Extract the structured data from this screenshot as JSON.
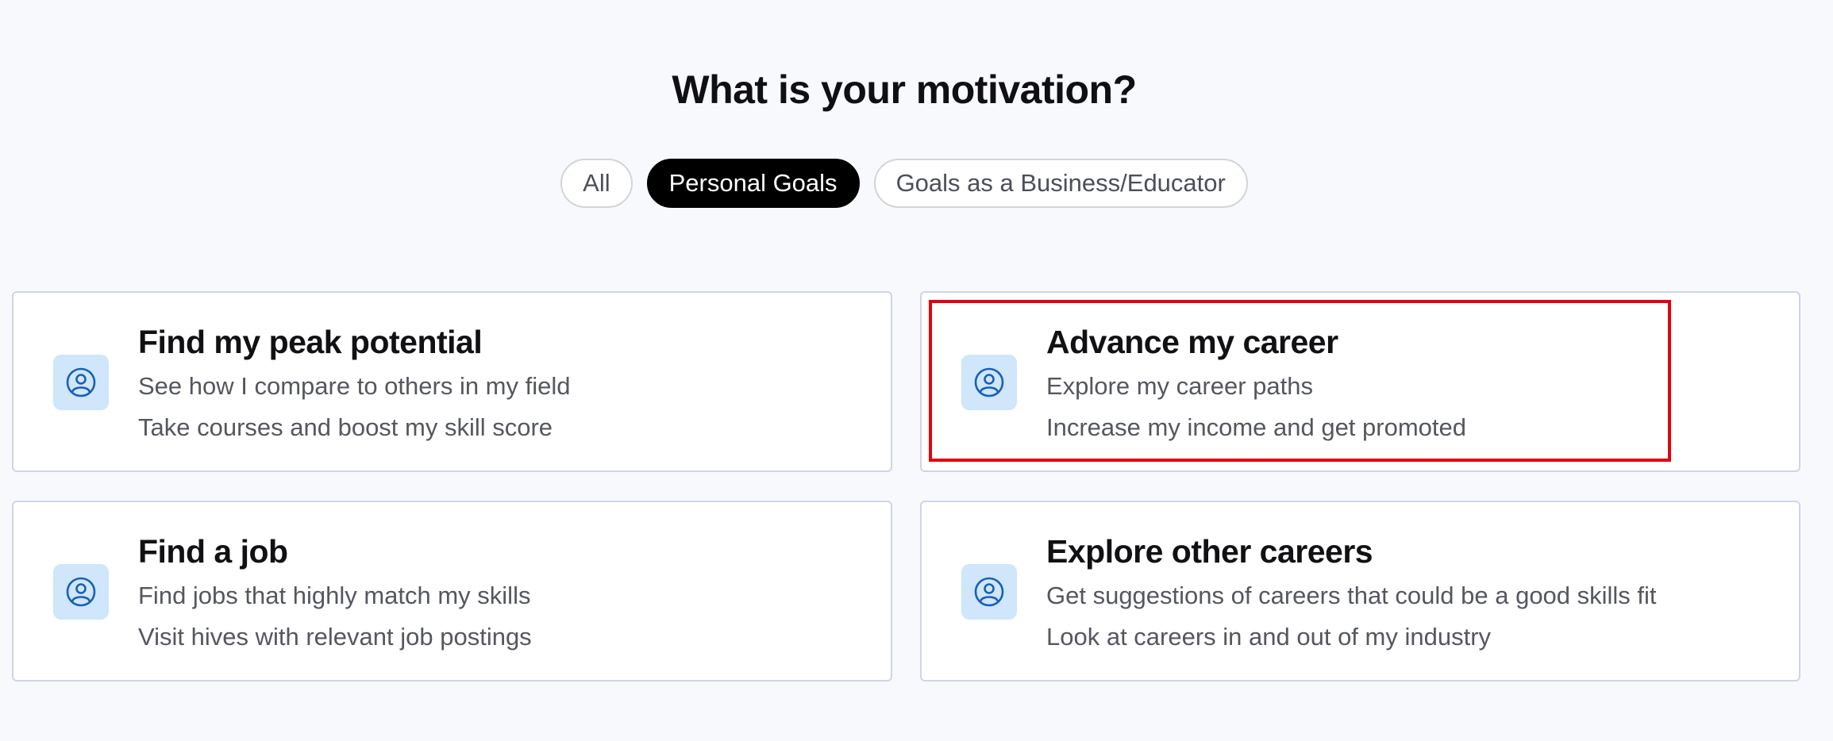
{
  "page": {
    "title": "What is your motivation?"
  },
  "tabs": [
    {
      "label": "All",
      "active": false
    },
    {
      "label": "Personal Goals",
      "active": true
    },
    {
      "label": "Goals as a Business/Educator",
      "active": false
    }
  ],
  "cards": [
    {
      "icon": "user-circle-icon",
      "title": "Find my peak potential",
      "lines": [
        "See how I compare to others in my field",
        "Take courses and boost my skill score"
      ]
    },
    {
      "icon": "user-circle-icon",
      "title": "Advance my career",
      "lines": [
        "Explore my career paths",
        "Increase my income and get promoted"
      ]
    },
    {
      "icon": "user-circle-icon",
      "title": "Find a job",
      "lines": [
        "Find jobs that highly match my skills",
        "Visit hives with relevant job postings"
      ]
    },
    {
      "icon": "user-circle-icon",
      "title": "Explore other careers",
      "lines": [
        "Get suggestions of careers that could be a good skills fit",
        "Look at careers in and out of my industry"
      ]
    }
  ],
  "colors": {
    "background": "#f8f9fc",
    "active_tab": "#000000",
    "icon_bg": "#cfe6fb",
    "icon_stroke": "#1a5fb4",
    "card_border": "#cfd4ea",
    "highlight": "#e3000f"
  }
}
